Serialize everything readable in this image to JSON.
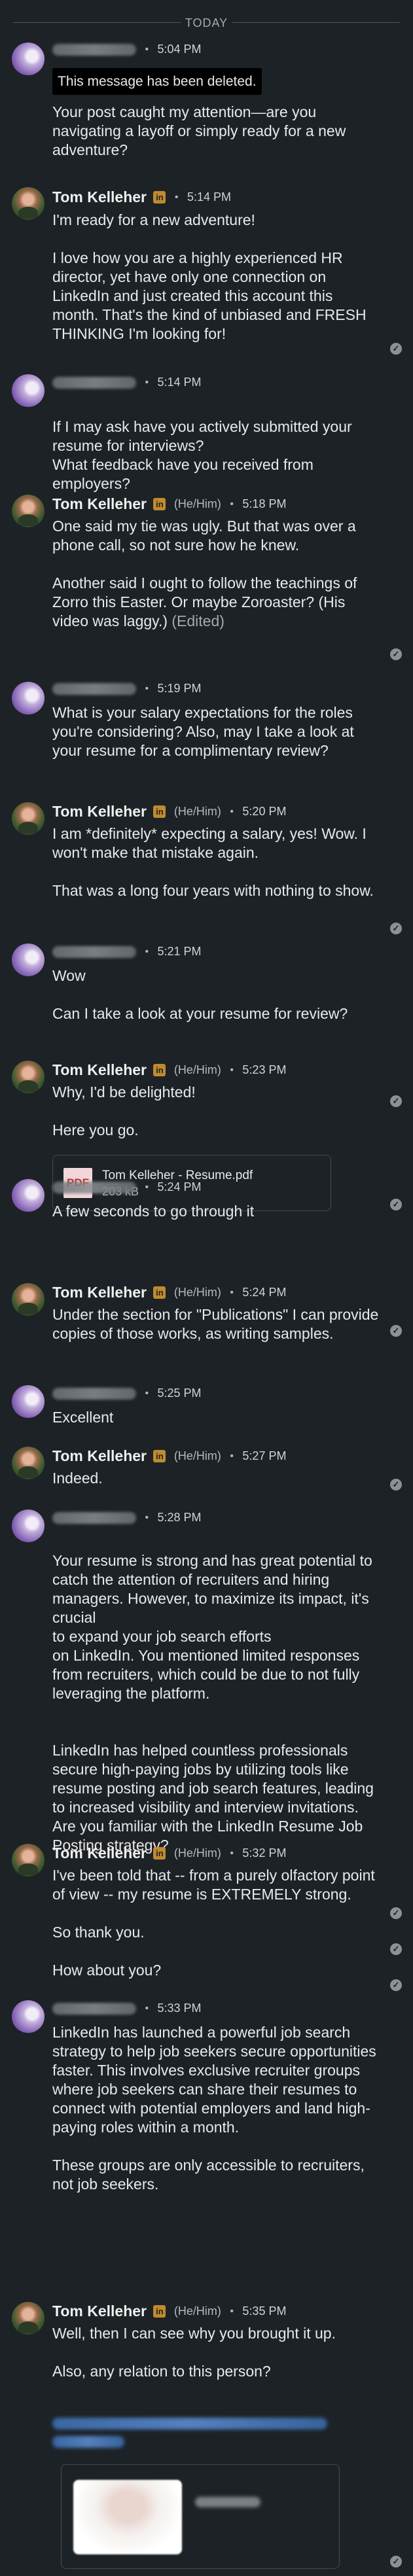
{
  "divider": {
    "label": "TODAY"
  },
  "messages": [
    {
      "sender": "",
      "pronouns": "",
      "time": "5:04 PM",
      "deleted_notice": "This message has been deleted.",
      "paragraphs": [
        "Your post caught my attention—are you navigating a layoff or simply ready for a new adventure?"
      ]
    },
    {
      "sender": "Tom Kelleher",
      "badge": "in",
      "pronouns": "",
      "time": "5:14 PM",
      "paragraphs": [
        "I'm ready for a new adventure!",
        "I love how you are a highly experienced HR director, yet have only one connection on LinkedIn and just created this account this month.  That's the kind of unbiased and FRESH THINKING I'm looking for!"
      ]
    },
    {
      "sender": "",
      "pronouns": "",
      "time": "5:14 PM",
      "paragraphs": [
        "If I may ask have you actively submitted your resume for interviews?\nWhat feedback have you received from employers?"
      ]
    },
    {
      "sender": "Tom Kelleher",
      "badge": "in",
      "pronouns": "(He/Him)",
      "time": "5:18 PM",
      "paragraphs": [
        "One said my tie was ugly.  But that was over a phone call, so not sure how he knew.",
        "Another said I ought to follow the teachings of Zorro this Easter.  Or maybe Zoroaster?  (His video was laggy.)"
      ],
      "edited": "(Edited)"
    },
    {
      "sender": "",
      "pronouns": "",
      "time": "5:19 PM",
      "paragraphs": [
        "What is your salary expectations for the roles you're considering? Also, may I take a look at your resume for a complimentary review?"
      ]
    },
    {
      "sender": "Tom Kelleher",
      "badge": "in",
      "pronouns": "(He/Him)",
      "time": "5:20 PM",
      "paragraphs": [
        "I am *definitely* expecting a salary, yes! Wow.  I won't make that mistake again.",
        "That was a long four years with nothing to show."
      ]
    },
    {
      "sender": "",
      "pronouns": "",
      "time": "5:21 PM",
      "paragraphs": [
        "Wow",
        "Can I take a look at your resume for review?"
      ]
    },
    {
      "sender": "Tom Kelleher",
      "badge": "in",
      "pronouns": "(He/Him)",
      "time": "5:23 PM",
      "paragraphs": [
        "Why, I'd be delighted!",
        "Here you go."
      ],
      "attachment": {
        "icon_label": "PDF",
        "name": "Tom Kelleher - Resume.pdf",
        "size": "203 kB"
      }
    },
    {
      "sender": "",
      "pronouns": "",
      "time": "5:24 PM",
      "paragraphs": [
        "A few seconds to go through it"
      ]
    },
    {
      "sender": "Tom Kelleher",
      "badge": "in",
      "pronouns": "(He/Him)",
      "time": "5:24 PM",
      "paragraphs": [
        "Under the section for \"Publications\" I can provide copies of those works, as writing samples."
      ]
    },
    {
      "sender": "",
      "pronouns": "",
      "time": "5:25 PM",
      "paragraphs": [
        "Excellent"
      ]
    },
    {
      "sender": "Tom Kelleher",
      "badge": "in",
      "pronouns": "(He/Him)",
      "time": "5:27 PM",
      "paragraphs": [
        "Indeed."
      ]
    },
    {
      "sender": "",
      "pronouns": "",
      "time": "5:28 PM",
      "paragraphs": [
        "Your resume is strong and has great potential to catch the attention of recruiters and hiring managers. However, to maximize its impact, it's crucial\nto expand your job search efforts\non LinkedIn. You mentioned limited responses from recruiters, which could be due to not fully leveraging the platform.",
        "LinkedIn has helped countless professionals secure high-paying jobs by utilizing tools like resume posting and job search features, leading to increased visibility and interview invitations. Are you familiar with the LinkedIn Resume Job Posting strategy?"
      ]
    },
    {
      "sender": "Tom Kelleher",
      "badge": "in",
      "pronouns": "(He/Him)",
      "time": "5:32 PM",
      "paragraphs": [
        "I've been told that -- from a purely olfactory point of view -- my resume is EXTREMELY strong.",
        "So thank you.",
        "How about you?"
      ]
    },
    {
      "sender": "",
      "pronouns": "",
      "time": "5:33 PM",
      "paragraphs": [
        "LinkedIn has launched a powerful job search strategy to help job seekers secure opportunities faster. This involves exclusive recruiter groups where job seekers can share their resumes to connect with potential employers and land high-paying roles within a month.",
        "These groups are only accessible to recruiters, not job seekers."
      ]
    },
    {
      "sender": "Tom Kelleher",
      "badge": "in",
      "pronouns": "(He/Him)",
      "time": "5:35 PM",
      "paragraphs": [
        "Well, then I can see why you brought it up.",
        "Also, any relation to this person?"
      ]
    }
  ],
  "colors": {
    "background": "#1d2226",
    "text": "#e9e9e9",
    "muted": "#b5b9bd",
    "badge": "#c08a2e",
    "check": "#8c9196"
  }
}
